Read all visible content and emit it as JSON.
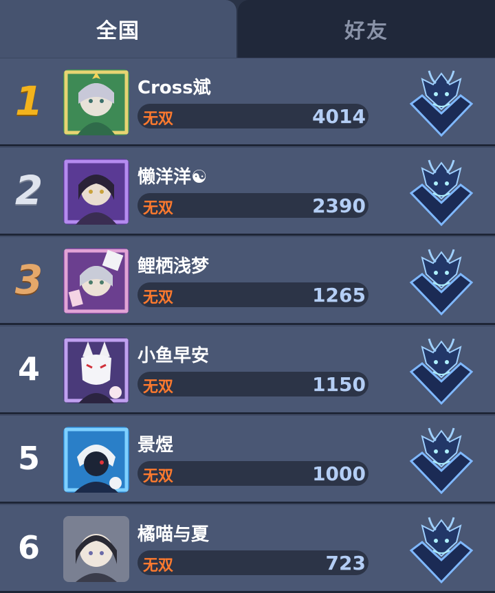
{
  "tabs": {
    "national": "全国",
    "friends": "好友"
  },
  "rows": [
    {
      "rank": "1",
      "name": "Cross斌",
      "tag": "无双",
      "score": "4014"
    },
    {
      "rank": "2",
      "name": "懒洋洋☯",
      "tag": "无双",
      "score": "2390"
    },
    {
      "rank": "3",
      "name": "鲤栖浅梦",
      "tag": "无双",
      "score": "1265"
    },
    {
      "rank": "4",
      "name": "小鱼早安",
      "tag": "无双",
      "score": "1150"
    },
    {
      "rank": "5",
      "name": "景煜",
      "tag": "无双",
      "score": "1000"
    },
    {
      "rank": "6",
      "name": "橘喵与夏",
      "tag": "无双",
      "score": "723"
    }
  ],
  "colors": {
    "active_tab": "#46536f",
    "inactive_tab": "#20283a",
    "tag": "#ff7a2e",
    "score": "#b4cef5",
    "gold": "#f3b31c"
  },
  "icons": {
    "emblem": "dragon-rank-emblem-icon",
    "avatar": "player-avatar"
  }
}
